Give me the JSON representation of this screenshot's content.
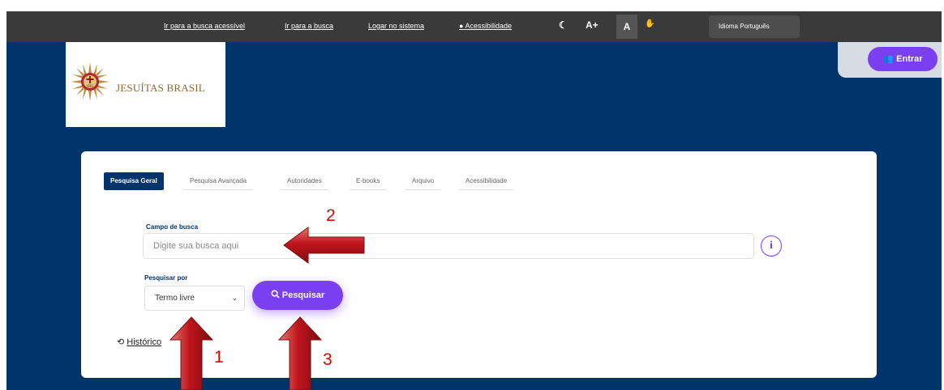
{
  "topbar": {
    "links": [
      "Ir para a busca acessível",
      "Ir para a busca",
      "Logar no sistema",
      "Acessibilidade"
    ],
    "contrast_label": "☾",
    "font_plus_label": "A+",
    "font_reset_label": "A",
    "libras_label": "✋",
    "language_label": "Idioma Português"
  },
  "brand": {
    "name": "JESUÍTAS BRASIL"
  },
  "header": {
    "login_label": "Entrar"
  },
  "tabs": [
    "Pesquisa Geral",
    "Pesquisa Avançada",
    "Autoridades",
    "E-books",
    "Arquivo",
    "Acessibilidade"
  ],
  "search": {
    "field_label": "Campo de busca",
    "placeholder": "Digite sua busca aqui",
    "value": "",
    "info_label": "i",
    "search_by_label": "Pesquisar por",
    "search_by_value": "Termo livre",
    "submit_label": "Pesquisar"
  },
  "history": {
    "label": "Histórico"
  },
  "annotations": {
    "markers": [
      "1",
      "2",
      "3"
    ],
    "arrow_color": "#c0141c"
  },
  "colors": {
    "navy": "#00346b",
    "purple": "#7b3ff2",
    "topbar": "#3a3a3a"
  },
  "icons": {
    "info": "info-circle-icon",
    "contrast": "moon-icon",
    "libras": "hand-icon",
    "login": "users-icon",
    "search": "search-icon",
    "chevron": "chevron-down-icon",
    "history": "history-icon"
  }
}
